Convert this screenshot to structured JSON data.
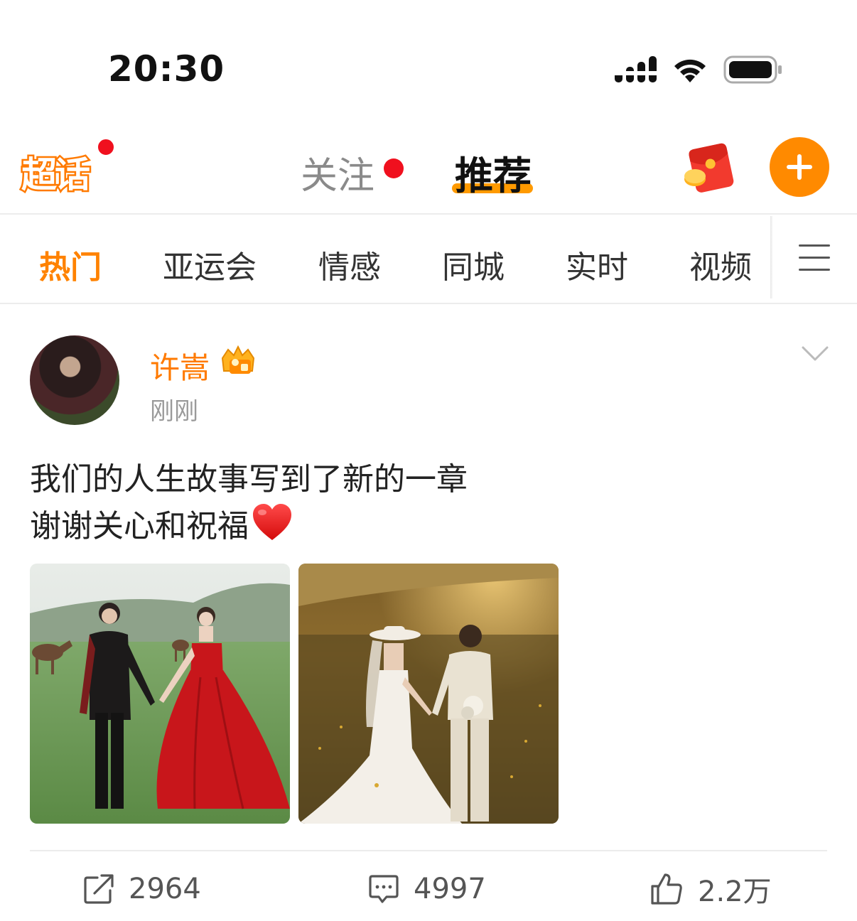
{
  "status_bar": {
    "time": "20:30"
  },
  "top_nav": {
    "super_topic_label": "超话",
    "tabs": [
      {
        "label": "关注",
        "has_dot": true
      },
      {
        "label": "推荐",
        "active": true
      }
    ]
  },
  "categories": [
    {
      "label": "热门",
      "active": true
    },
    {
      "label": "亚运会"
    },
    {
      "label": "情感"
    },
    {
      "label": "同城"
    },
    {
      "label": "实时"
    },
    {
      "label": "视频"
    }
  ],
  "post": {
    "author": "许嵩",
    "time": "刚刚",
    "text_line1": "我们的人生故事写到了新的一章",
    "text_line2": "谢谢关心和祝福",
    "actions": {
      "repost": "2964",
      "comment": "4997",
      "like": "2.2万"
    }
  },
  "colors": {
    "accent": "#ff8200",
    "notification_dot": "#f0101e"
  }
}
